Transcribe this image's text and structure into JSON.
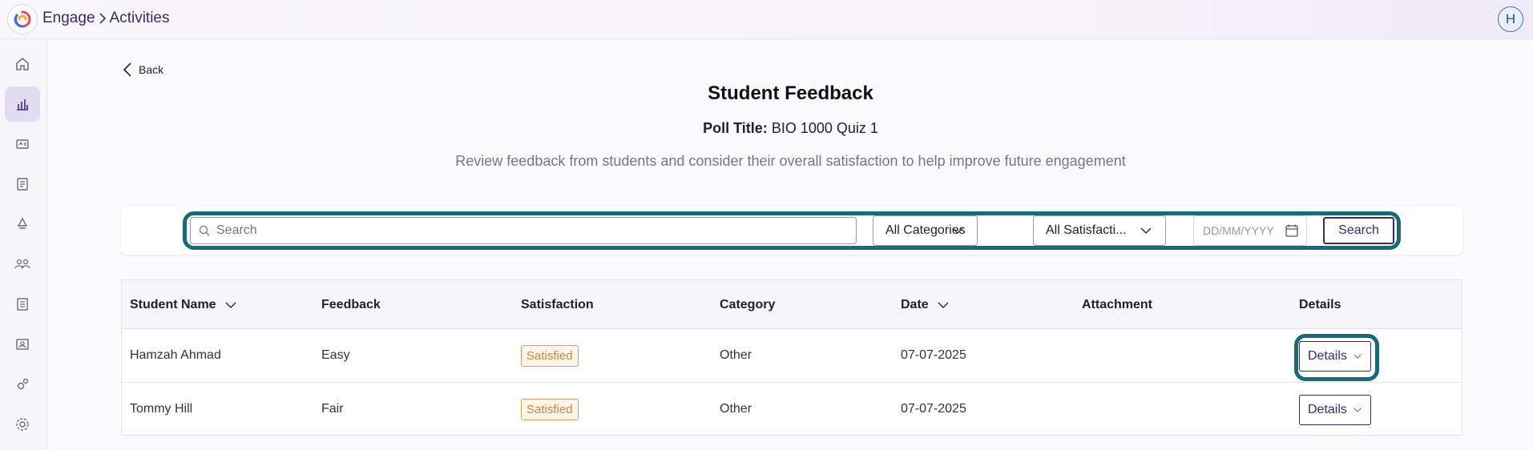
{
  "header": {
    "breadcrumb": [
      "Engage",
      "Activities"
    ],
    "avatar_initial": "H"
  },
  "sidebar": {
    "items": [
      {
        "icon": "home-icon"
      },
      {
        "icon": "bar-chart-icon",
        "active": true
      },
      {
        "icon": "id-card-icon"
      },
      {
        "icon": "notebook-icon"
      },
      {
        "icon": "recycle-icon"
      },
      {
        "icon": "users-icon"
      },
      {
        "icon": "document-icon"
      },
      {
        "icon": "contact-card-icon"
      },
      {
        "icon": "gears-icon"
      },
      {
        "icon": "settings-icon"
      }
    ]
  },
  "page": {
    "back_label": "Back",
    "title": "Student Feedback",
    "poll_label": "Poll Title:",
    "poll_value": "BIO 1000 Quiz 1",
    "description": "Review feedback from students and consider their overall satisfaction to help improve future engagement"
  },
  "filters": {
    "search_placeholder": "Search",
    "category": "All Categories",
    "satisfaction": "All Satisfacti...",
    "date_placeholder": "DD/MM/YYYY",
    "search_button": "Search"
  },
  "table": {
    "columns": [
      "Student Name",
      "Feedback",
      "Satisfaction",
      "Category",
      "Date",
      "Attachment",
      "Details"
    ],
    "rows": [
      {
        "student": "Hamzah Ahmad",
        "feedback": "Easy",
        "satisfaction": "Satisfied",
        "category": "Other",
        "date": "07-07-2025",
        "attachment": "",
        "details": "Details"
      },
      {
        "student": "Tommy Hill",
        "feedback": "Fair",
        "satisfaction": "Satisfied",
        "category": "Other",
        "date": "07-07-2025",
        "attachment": "",
        "details": "Details"
      }
    ]
  },
  "colors": {
    "accent": "#3b2a6b",
    "highlight": "#176b78",
    "badge": "#c8893e"
  }
}
